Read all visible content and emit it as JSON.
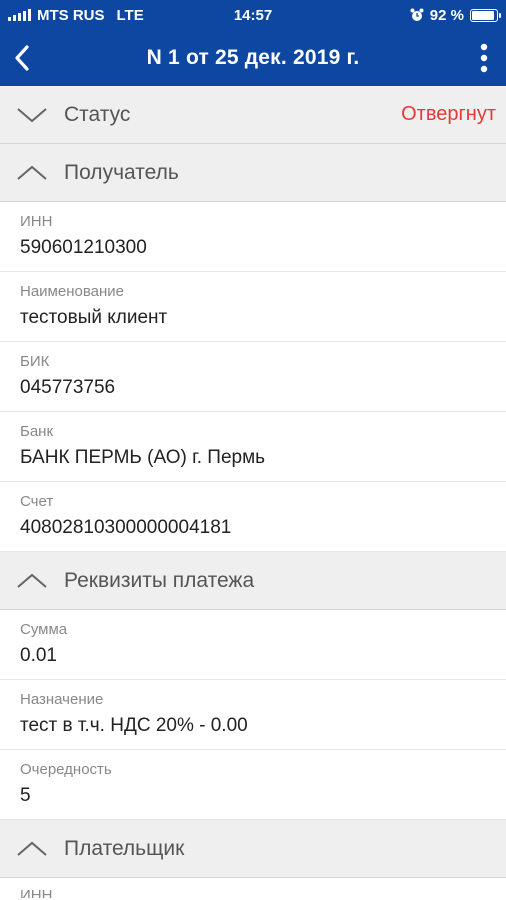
{
  "status_bar": {
    "carrier": "MTS RUS",
    "network": "LTE",
    "time": "14:57",
    "battery": "92 %",
    "battery_level": 0.92,
    "alarm_icon": "alarm-icon"
  },
  "app_bar": {
    "title": "N 1 от 25 дек. 2019 г.",
    "back_icon": "chevron-left-icon",
    "menu_icon": "more-vertical-icon"
  },
  "status_section": {
    "label": "Статус",
    "value": "Отвергнут",
    "value_color": "#e53935"
  },
  "recipient": {
    "label": "Получатель",
    "fields": [
      {
        "label": "ИНН",
        "value": "590601210300"
      },
      {
        "label": "Наименование",
        "value": "тестовый клиент"
      },
      {
        "label": "БИК",
        "value": "045773756"
      },
      {
        "label": "Банк",
        "value": "БАНК ПЕРМЬ (АО) г. Пермь"
      },
      {
        "label": "Счет",
        "value": "40802810300000004181"
      }
    ]
  },
  "payment": {
    "label": "Реквизиты платежа",
    "fields": [
      {
        "label": "Сумма",
        "value": "0.01"
      },
      {
        "label": "Назначение",
        "value": "тест в т.ч. НДС 20% - 0.00"
      },
      {
        "label": "Очередность",
        "value": "5"
      }
    ]
  },
  "payer": {
    "label": "Плательщик",
    "fields": [
      {
        "label": "ИНН",
        "value": ""
      }
    ]
  },
  "colors": {
    "brand": "#0d47a1",
    "header_bg": "#efefef",
    "rejected": "#e53935"
  }
}
